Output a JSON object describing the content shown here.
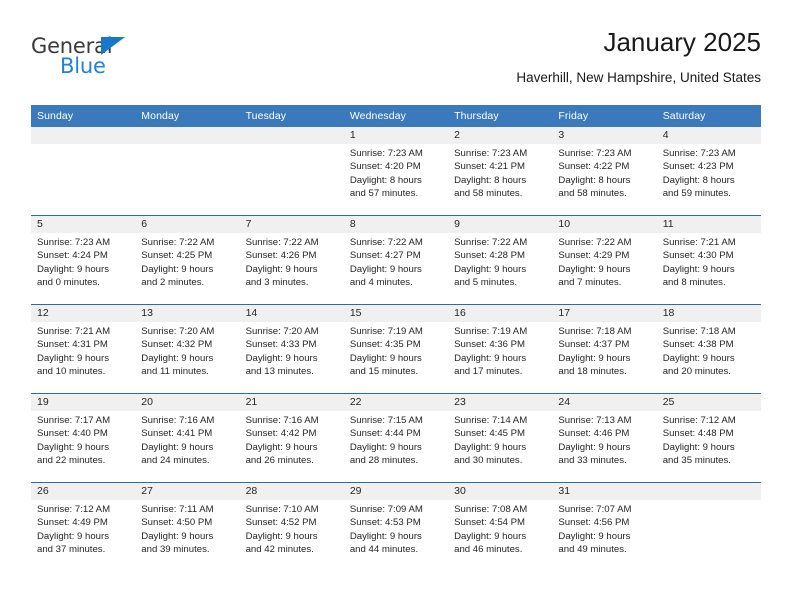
{
  "brand": {
    "name_top": "General",
    "name_bottom": "Blue",
    "accent_color": "#1f83d6",
    "triangle_color": "#1878c8"
  },
  "header": {
    "title": "January 2025",
    "subtitle": "Haverhill, New Hampshire, United States"
  },
  "theme": {
    "header_blue": "#3b79bd",
    "row_divider_blue": "#2e6da4",
    "daynum_band_gray": "#f0f0f0",
    "text_color": "#262626"
  },
  "weekday_headers": [
    "Sunday",
    "Monday",
    "Tuesday",
    "Wednesday",
    "Thursday",
    "Friday",
    "Saturday"
  ],
  "weeks": [
    [
      {
        "day": "",
        "sunrise": "",
        "sunset": "",
        "daylight_line1": "",
        "daylight_line2": ""
      },
      {
        "day": "",
        "sunrise": "",
        "sunset": "",
        "daylight_line1": "",
        "daylight_line2": ""
      },
      {
        "day": "",
        "sunrise": "",
        "sunset": "",
        "daylight_line1": "",
        "daylight_line2": ""
      },
      {
        "day": "1",
        "sunrise": "Sunrise: 7:23 AM",
        "sunset": "Sunset: 4:20 PM",
        "daylight_line1": "Daylight: 8 hours",
        "daylight_line2": "and 57 minutes."
      },
      {
        "day": "2",
        "sunrise": "Sunrise: 7:23 AM",
        "sunset": "Sunset: 4:21 PM",
        "daylight_line1": "Daylight: 8 hours",
        "daylight_line2": "and 58 minutes."
      },
      {
        "day": "3",
        "sunrise": "Sunrise: 7:23 AM",
        "sunset": "Sunset: 4:22 PM",
        "daylight_line1": "Daylight: 8 hours",
        "daylight_line2": "and 58 minutes."
      },
      {
        "day": "4",
        "sunrise": "Sunrise: 7:23 AM",
        "sunset": "Sunset: 4:23 PM",
        "daylight_line1": "Daylight: 8 hours",
        "daylight_line2": "and 59 minutes."
      }
    ],
    [
      {
        "day": "5",
        "sunrise": "Sunrise: 7:23 AM",
        "sunset": "Sunset: 4:24 PM",
        "daylight_line1": "Daylight: 9 hours",
        "daylight_line2": "and 0 minutes."
      },
      {
        "day": "6",
        "sunrise": "Sunrise: 7:22 AM",
        "sunset": "Sunset: 4:25 PM",
        "daylight_line1": "Daylight: 9 hours",
        "daylight_line2": "and 2 minutes."
      },
      {
        "day": "7",
        "sunrise": "Sunrise: 7:22 AM",
        "sunset": "Sunset: 4:26 PM",
        "daylight_line1": "Daylight: 9 hours",
        "daylight_line2": "and 3 minutes."
      },
      {
        "day": "8",
        "sunrise": "Sunrise: 7:22 AM",
        "sunset": "Sunset: 4:27 PM",
        "daylight_line1": "Daylight: 9 hours",
        "daylight_line2": "and 4 minutes."
      },
      {
        "day": "9",
        "sunrise": "Sunrise: 7:22 AM",
        "sunset": "Sunset: 4:28 PM",
        "daylight_line1": "Daylight: 9 hours",
        "daylight_line2": "and 5 minutes."
      },
      {
        "day": "10",
        "sunrise": "Sunrise: 7:22 AM",
        "sunset": "Sunset: 4:29 PM",
        "daylight_line1": "Daylight: 9 hours",
        "daylight_line2": "and 7 minutes."
      },
      {
        "day": "11",
        "sunrise": "Sunrise: 7:21 AM",
        "sunset": "Sunset: 4:30 PM",
        "daylight_line1": "Daylight: 9 hours",
        "daylight_line2": "and 8 minutes."
      }
    ],
    [
      {
        "day": "12",
        "sunrise": "Sunrise: 7:21 AM",
        "sunset": "Sunset: 4:31 PM",
        "daylight_line1": "Daylight: 9 hours",
        "daylight_line2": "and 10 minutes."
      },
      {
        "day": "13",
        "sunrise": "Sunrise: 7:20 AM",
        "sunset": "Sunset: 4:32 PM",
        "daylight_line1": "Daylight: 9 hours",
        "daylight_line2": "and 11 minutes."
      },
      {
        "day": "14",
        "sunrise": "Sunrise: 7:20 AM",
        "sunset": "Sunset: 4:33 PM",
        "daylight_line1": "Daylight: 9 hours",
        "daylight_line2": "and 13 minutes."
      },
      {
        "day": "15",
        "sunrise": "Sunrise: 7:19 AM",
        "sunset": "Sunset: 4:35 PM",
        "daylight_line1": "Daylight: 9 hours",
        "daylight_line2": "and 15 minutes."
      },
      {
        "day": "16",
        "sunrise": "Sunrise: 7:19 AM",
        "sunset": "Sunset: 4:36 PM",
        "daylight_line1": "Daylight: 9 hours",
        "daylight_line2": "and 17 minutes."
      },
      {
        "day": "17",
        "sunrise": "Sunrise: 7:18 AM",
        "sunset": "Sunset: 4:37 PM",
        "daylight_line1": "Daylight: 9 hours",
        "daylight_line2": "and 18 minutes."
      },
      {
        "day": "18",
        "sunrise": "Sunrise: 7:18 AM",
        "sunset": "Sunset: 4:38 PM",
        "daylight_line1": "Daylight: 9 hours",
        "daylight_line2": "and 20 minutes."
      }
    ],
    [
      {
        "day": "19",
        "sunrise": "Sunrise: 7:17 AM",
        "sunset": "Sunset: 4:40 PM",
        "daylight_line1": "Daylight: 9 hours",
        "daylight_line2": "and 22 minutes."
      },
      {
        "day": "20",
        "sunrise": "Sunrise: 7:16 AM",
        "sunset": "Sunset: 4:41 PM",
        "daylight_line1": "Daylight: 9 hours",
        "daylight_line2": "and 24 minutes."
      },
      {
        "day": "21",
        "sunrise": "Sunrise: 7:16 AM",
        "sunset": "Sunset: 4:42 PM",
        "daylight_line1": "Daylight: 9 hours",
        "daylight_line2": "and 26 minutes."
      },
      {
        "day": "22",
        "sunrise": "Sunrise: 7:15 AM",
        "sunset": "Sunset: 4:44 PM",
        "daylight_line1": "Daylight: 9 hours",
        "daylight_line2": "and 28 minutes."
      },
      {
        "day": "23",
        "sunrise": "Sunrise: 7:14 AM",
        "sunset": "Sunset: 4:45 PM",
        "daylight_line1": "Daylight: 9 hours",
        "daylight_line2": "and 30 minutes."
      },
      {
        "day": "24",
        "sunrise": "Sunrise: 7:13 AM",
        "sunset": "Sunset: 4:46 PM",
        "daylight_line1": "Daylight: 9 hours",
        "daylight_line2": "and 33 minutes."
      },
      {
        "day": "25",
        "sunrise": "Sunrise: 7:12 AM",
        "sunset": "Sunset: 4:48 PM",
        "daylight_line1": "Daylight: 9 hours",
        "daylight_line2": "and 35 minutes."
      }
    ],
    [
      {
        "day": "26",
        "sunrise": "Sunrise: 7:12 AM",
        "sunset": "Sunset: 4:49 PM",
        "daylight_line1": "Daylight: 9 hours",
        "daylight_line2": "and 37 minutes."
      },
      {
        "day": "27",
        "sunrise": "Sunrise: 7:11 AM",
        "sunset": "Sunset: 4:50 PM",
        "daylight_line1": "Daylight: 9 hours",
        "daylight_line2": "and 39 minutes."
      },
      {
        "day": "28",
        "sunrise": "Sunrise: 7:10 AM",
        "sunset": "Sunset: 4:52 PM",
        "daylight_line1": "Daylight: 9 hours",
        "daylight_line2": "and 42 minutes."
      },
      {
        "day": "29",
        "sunrise": "Sunrise: 7:09 AM",
        "sunset": "Sunset: 4:53 PM",
        "daylight_line1": "Daylight: 9 hours",
        "daylight_line2": "and 44 minutes."
      },
      {
        "day": "30",
        "sunrise": "Sunrise: 7:08 AM",
        "sunset": "Sunset: 4:54 PM",
        "daylight_line1": "Daylight: 9 hours",
        "daylight_line2": "and 46 minutes."
      },
      {
        "day": "31",
        "sunrise": "Sunrise: 7:07 AM",
        "sunset": "Sunset: 4:56 PM",
        "daylight_line1": "Daylight: 9 hours",
        "daylight_line2": "and 49 minutes."
      },
      {
        "day": "",
        "sunrise": "",
        "sunset": "",
        "daylight_line1": "",
        "daylight_line2": ""
      }
    ]
  ]
}
